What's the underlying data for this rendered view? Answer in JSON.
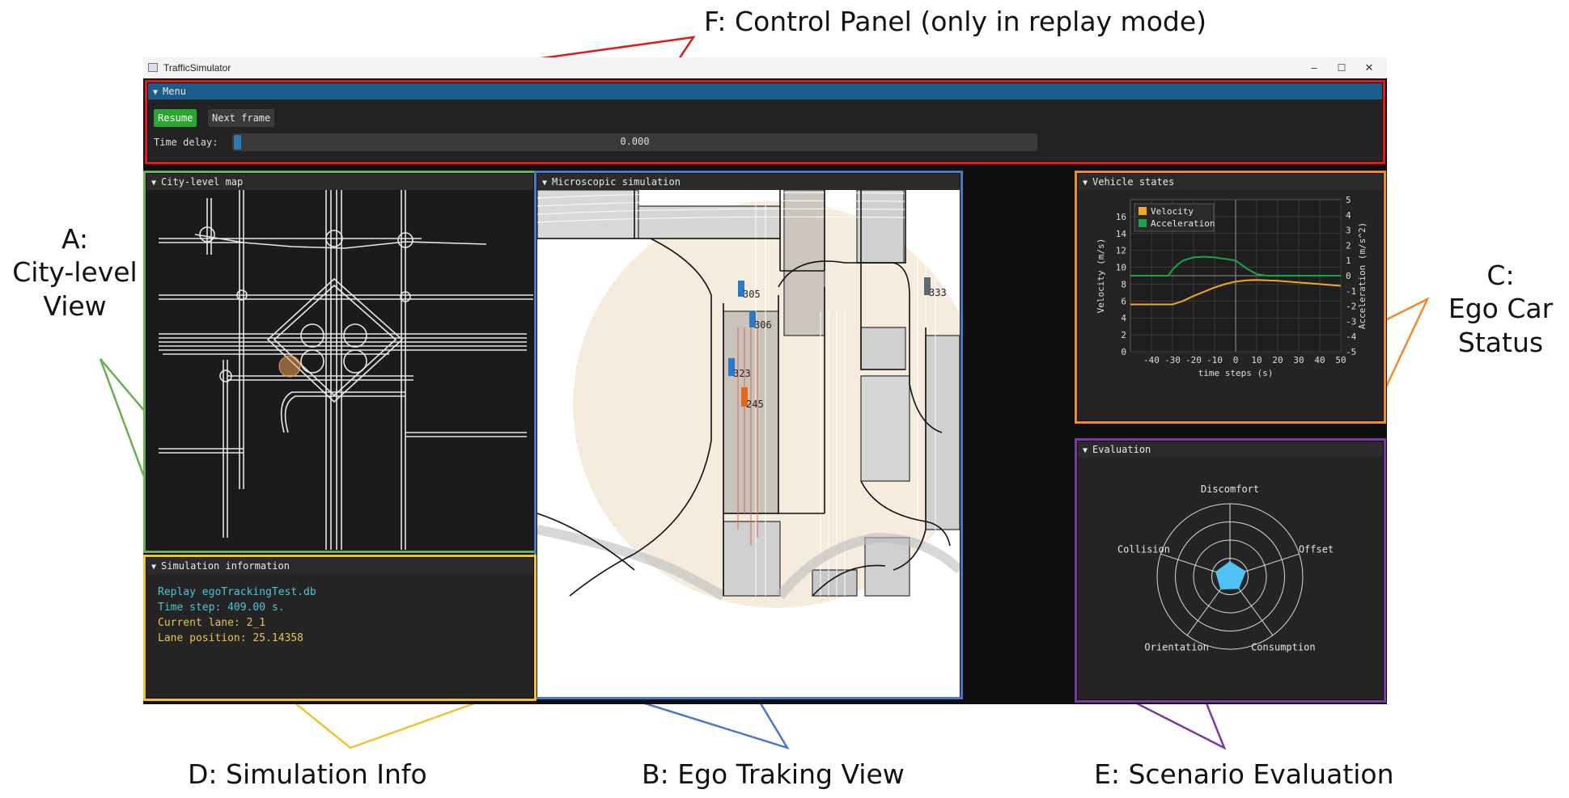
{
  "callouts": {
    "f": "F: Control Panel (only in replay mode)",
    "a_line1": "A:",
    "a_line2": "City-level",
    "a_line3": "View",
    "c_line1": "C:",
    "c_line2": "Ego Car",
    "c_line3": "Status",
    "d": "D: Simulation Info",
    "b": "B: Ego Traking View",
    "e": "E: Scenario Evaluation"
  },
  "window": {
    "title": "TrafficSimulator",
    "minimize": "–",
    "maximize": "☐",
    "close": "✕"
  },
  "menu": {
    "title": "Menu",
    "resume_label": "Resume",
    "next_frame_label": "Next frame",
    "time_delay_label": "Time delay:",
    "time_delay_value": "0.000"
  },
  "panels": {
    "city_map_title": "City-level map",
    "micro_sim_title": "Microscopic simulation",
    "vehicle_states_title": "Vehicle states",
    "evaluation_title": "Evaluation",
    "sim_info_title": "Simulation information"
  },
  "sim_info": {
    "replay": "Replay egoTrackingTest.db",
    "time_step": "Time step: 409.00 s.",
    "current_lane": "Current lane: 2_1",
    "lane_position": "Lane position: 25.14358"
  },
  "vehicles": [
    {
      "id": "305",
      "color": "#2e78c8"
    },
    {
      "id": "306",
      "color": "#2e78c8"
    },
    {
      "id": "323",
      "color": "#2e78c8"
    },
    {
      "id": "245",
      "color": "#e06a1a"
    },
    {
      "id": "333",
      "color": "#5f6a70"
    }
  ],
  "chart_data": {
    "type": "line",
    "xlabel": "time steps (s)",
    "ylabel": "Velocity (m/s)",
    "y2label": "Acceleration (m/s^2)",
    "xlim": [
      -50,
      50
    ],
    "ylim": [
      0,
      18
    ],
    "y2lim": [
      -5,
      5
    ],
    "xticks": [
      -40,
      -30,
      -20,
      -10,
      0,
      10,
      20,
      30,
      40,
      50
    ],
    "yticks": [
      0,
      2,
      4,
      6,
      8,
      10,
      12,
      14,
      16
    ],
    "y2ticks": [
      -5,
      -4,
      -3,
      -2,
      -1,
      0,
      1,
      2,
      3,
      4,
      5
    ],
    "grid": true,
    "legend": "top-left",
    "series": [
      {
        "name": "Velocity",
        "axis": "left",
        "color": "#f5a623",
        "x": [
          -50,
          -35,
          -30,
          -25,
          -20,
          -15,
          -10,
          -5,
          0,
          5,
          10,
          15,
          20,
          30,
          40,
          50
        ],
        "values": [
          5.6,
          5.6,
          5.6,
          6.0,
          6.6,
          7.1,
          7.6,
          8.0,
          8.3,
          8.45,
          8.5,
          8.45,
          8.4,
          8.2,
          8.0,
          7.8
        ]
      },
      {
        "name": "Acceleration",
        "axis": "right",
        "color": "#1aa34a",
        "x": [
          -50,
          -35,
          -32,
          -30,
          -27,
          -25,
          -20,
          -15,
          -10,
          -5,
          0,
          5,
          10,
          15,
          20,
          30,
          40,
          50
        ],
        "values": [
          0,
          0,
          0,
          0.4,
          0.8,
          1.0,
          1.2,
          1.25,
          1.2,
          1.1,
          1.0,
          0.5,
          0.1,
          0,
          0,
          0,
          0,
          0
        ]
      }
    ]
  },
  "radar": {
    "labels": [
      "Discomfort",
      "Offset",
      "Consumption",
      "Orientation",
      "Collision"
    ],
    "values": [
      0.2,
      0.22,
      0.2,
      0.21,
      0.2
    ],
    "fill": "#4fc3f7"
  },
  "colors": {
    "frame_f": "#e11b1b",
    "frame_a": "#6ab04c",
    "frame_b": "#4a78c8",
    "frame_c": "#f08a2a",
    "frame_d": "#f2c12e",
    "frame_e": "#7a3aa0",
    "info_cyan": "#4fc3d4",
    "info_yellow": "#e8c34a",
    "resume_green": "#2aa630"
  }
}
